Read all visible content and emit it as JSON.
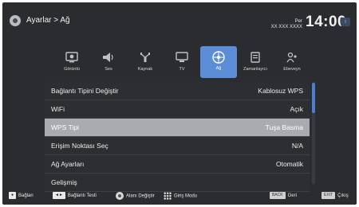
{
  "header": {
    "breadcrumb": "Ayarlar > Ağ",
    "day": "Per",
    "date": "XX XXX XXXX",
    "time": "14:00",
    "time_button": "i"
  },
  "tabs": [
    {
      "label": "Görüntü",
      "icon": "picture-icon"
    },
    {
      "label": "Ses",
      "icon": "sound-icon"
    },
    {
      "label": "Kaynak",
      "icon": "source-icon"
    },
    {
      "label": "TV",
      "icon": "tv-icon"
    },
    {
      "label": "Ağ",
      "icon": "network-icon",
      "active": true
    },
    {
      "label": "Zamanlayıcı",
      "icon": "timer-icon"
    },
    {
      "label": "Ebeveyn",
      "icon": "parental-icon"
    }
  ],
  "menu": [
    {
      "label": "Bağlantı Tipini Değiştir",
      "value": "Kablosuz WPS"
    },
    {
      "label": "WiFi",
      "value": "Açık"
    },
    {
      "label": "WPS Tipi",
      "value": "Tuşa Basma",
      "selected": true
    },
    {
      "label": "Erişim Noktası Seç",
      "value": "N/A"
    },
    {
      "label": "Ağ Ayarları",
      "value": "Otomatik"
    },
    {
      "label": "Gelişmiş",
      "value": ""
    }
  ],
  "footer": {
    "connect_key": "●",
    "connect": "Bağlan",
    "test_key": "◄►",
    "test": "Bağlantı Testi",
    "change_area": "Alanı Değiştir",
    "input_mode": "Giriş Modu",
    "back_key": "BACK",
    "back": "Geri",
    "exit_key": "EXIT",
    "exit": "Çıkış"
  },
  "colors": {
    "background": "#2b2c30",
    "accent": "#5b8ed6",
    "selected_row": "#a9abaf"
  }
}
